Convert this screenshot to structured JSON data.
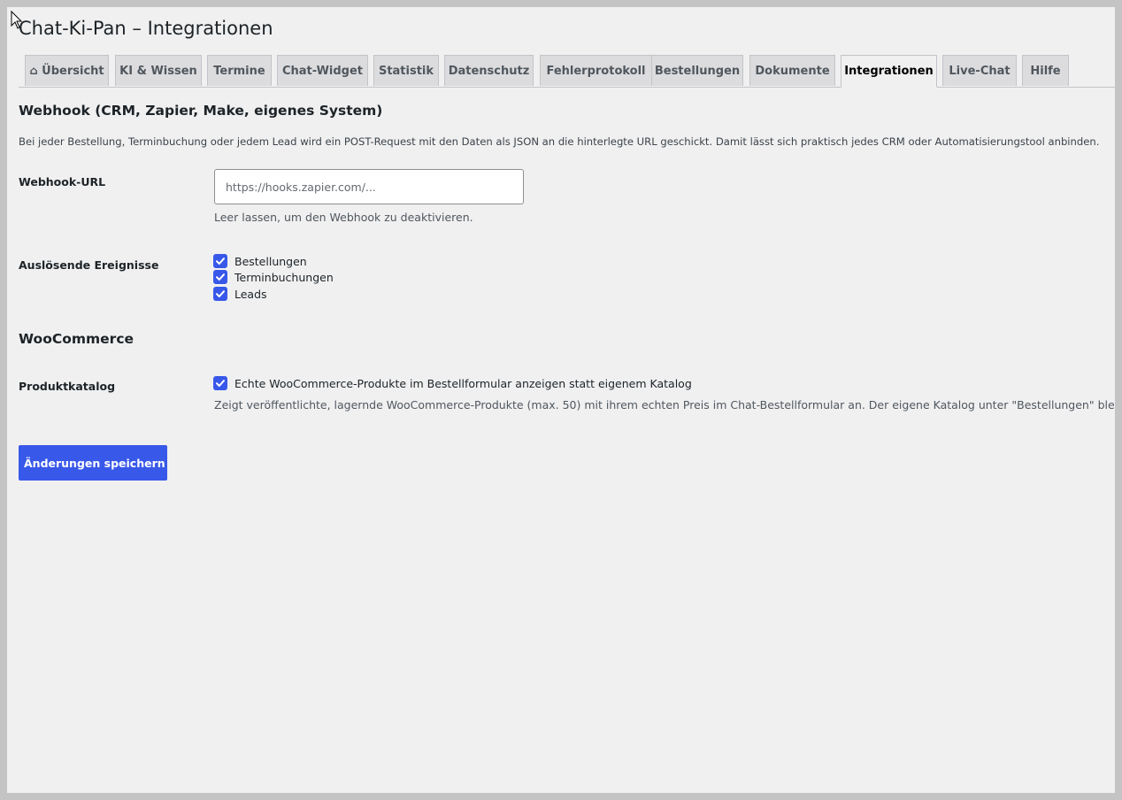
{
  "page": {
    "title": "Chat-Ki-Pan – Integrationen"
  },
  "tabs": [
    {
      "label": "⌂ Übersicht",
      "active": false
    },
    {
      "label": "KI & Wissen",
      "active": false
    },
    {
      "label": "Termine",
      "active": false
    },
    {
      "label": "Chat-Widget",
      "active": false
    },
    {
      "label": "Statistik",
      "active": false
    },
    {
      "label": "Datenschutz",
      "active": false
    },
    {
      "label": "Fehlerprotokoll",
      "active": false
    },
    {
      "label": "Bestellungen",
      "active": false
    },
    {
      "label": "Dokumente",
      "active": false
    },
    {
      "label": "Integrationen",
      "active": true
    },
    {
      "label": "Live-Chat",
      "active": false
    },
    {
      "label": "Hilfe",
      "active": false
    }
  ],
  "webhook": {
    "section_title": "Webhook (CRM, Zapier, Make, eigenes System)",
    "description": "Bei jeder Bestellung, Terminbuchung oder jedem Lead wird ein POST-Request mit den Daten als JSON an die hinterlegte URL geschickt. Damit lässt sich praktisch jedes CRM oder Automatisierungstool anbinden.",
    "url_label": "Webhook-URL",
    "url_value": "",
    "url_placeholder": "https://hooks.zapier.com/...",
    "url_hint": "Leer lassen, um den Webhook zu deaktivieren.",
    "events_label": "Auslösende Ereignisse",
    "events": [
      {
        "label": "Bestellungen",
        "checked": true
      },
      {
        "label": "Terminbuchungen",
        "checked": true
      },
      {
        "label": "Leads",
        "checked": true
      }
    ]
  },
  "woocommerce": {
    "section_title": "WooCommerce",
    "catalog_label": "Produktkatalog",
    "catalog_checkbox_label": "Echte WooCommerce-Produkte im Bestellformular anzeigen statt eigenem Katalog",
    "catalog_checked": true,
    "catalog_hint": "Zeigt veröffentlichte, lagernde WooCommerce-Produkte (max. 50) mit ihrem echten Preis im Chat-Bestellformular an. Der eigene Katalog unter \"Bestellungen\" bleibt b"
  },
  "actions": {
    "save_label": "Änderungen speichern"
  },
  "colors": {
    "accent": "#3858e9",
    "background": "#f0f0f1",
    "tab_inactive": "#dcdcde"
  }
}
